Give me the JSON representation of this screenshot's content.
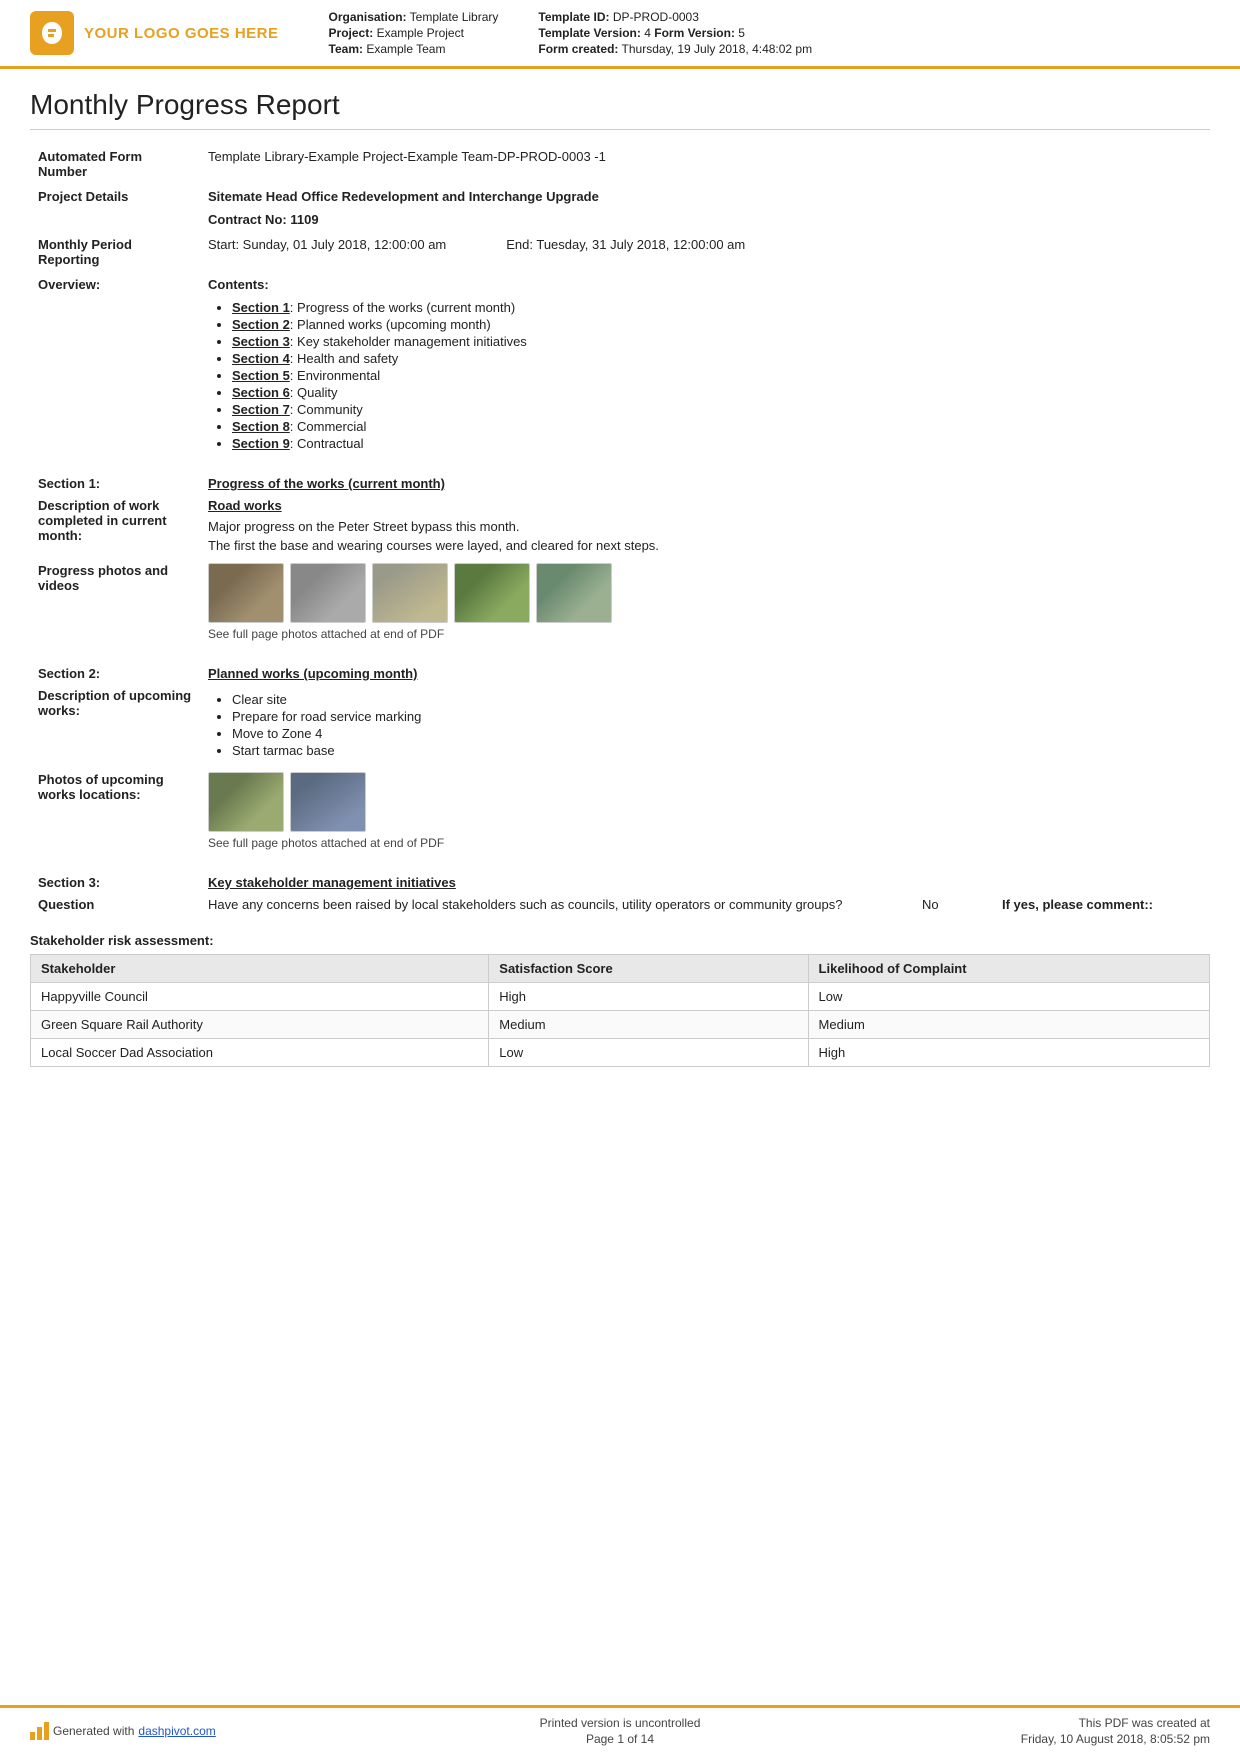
{
  "header": {
    "logo_text": "YOUR LOGO GOES HERE",
    "org_label": "Organisation:",
    "org_value": "Template Library",
    "project_label": "Project:",
    "project_value": "Example Project",
    "team_label": "Team:",
    "team_value": "Example Team",
    "template_id_label": "Template ID:",
    "template_id_value": "DP-PROD-0003",
    "template_version_label": "Template Version:",
    "template_version_value": "4",
    "form_version_label": "Form Version:",
    "form_version_value": "5",
    "form_created_label": "Form created:",
    "form_created_value": "Thursday, 19 July 2018, 4:48:02 pm"
  },
  "report": {
    "title": "Monthly Progress Report",
    "form_number_label": "Automated Form Number",
    "form_number_value": "Template Library-Example Project-Example Team-DP-PROD-0003   -1",
    "project_details_label": "Project Details",
    "project_details_value": "Sitemate Head Office Redevelopment and Interchange Upgrade",
    "contract_label": "Contract No:",
    "contract_value": "1109",
    "period_label": "Monthly Period Reporting",
    "period_start": "Start: Sunday, 01 July 2018, 12:00:00 am",
    "period_end": "End: Tuesday, 31 July 2018, 12:00:00 am",
    "overview_label": "Overview:",
    "contents_label": "Contents:",
    "contents": [
      {
        "id": "Section 1",
        "text": "Progress of the works (current month)"
      },
      {
        "id": "Section 2",
        "text": "Planned works (upcoming month)"
      },
      {
        "id": "Section 3",
        "text": "Key stakeholder management initiatives"
      },
      {
        "id": "Section 4",
        "text": "Health and safety"
      },
      {
        "id": "Section 5",
        "text": "Environmental"
      },
      {
        "id": "Section 6",
        "text": "Quality"
      },
      {
        "id": "Section 7",
        "text": "Community"
      },
      {
        "id": "Section 8",
        "text": "Commercial"
      },
      {
        "id": "Section 9",
        "text": "Contractual"
      }
    ],
    "section1_label": "Section 1:",
    "section1_title": "Progress of the works (current month)",
    "desc_work_label": "Description of work completed in current month:",
    "road_works_title": "Road works",
    "road_works_desc1": "Major progress on the Peter Street bypass this month.",
    "road_works_desc2": "The first the base and wearing courses were layed, and cleared for next steps.",
    "photos_label": "Progress photos and videos",
    "photos_caption": "See full page photos attached at end of PDF",
    "section2_label": "Section 2:",
    "section2_title": "Planned works (upcoming month)",
    "upcoming_works_label": "Description of upcoming works:",
    "upcoming_works": [
      "Clear site",
      "Prepare for road service marking",
      "Move to Zone 4",
      "Start tarmac base"
    ],
    "upcoming_photos_label": "Photos of upcoming works locations:",
    "upcoming_photos_caption": "See full page photos attached at end of PDF",
    "section3_label": "Section 3:",
    "section3_title": "Key stakeholder management initiatives",
    "question_label": "Question",
    "question_text": "Have any concerns been raised by local stakeholders such as councils, utility operators or community groups?",
    "question_answer": "No",
    "question_if_yes": "If yes, please comment::",
    "stakeholder_title": "Stakeholder risk assessment:",
    "stake_headers": [
      "Stakeholder",
      "Satisfaction Score",
      "Likelihood of Complaint"
    ],
    "stake_rows": [
      [
        "Happyville Council",
        "High",
        "Low"
      ],
      [
        "Green Square Rail Authority",
        "Medium",
        "Medium"
      ],
      [
        "Local Soccer Dad Association",
        "Low",
        "High"
      ]
    ]
  },
  "footer": {
    "generated_text": "Generated with",
    "link_text": "dashpivot.com",
    "printed_line1": "Printed version is uncontrolled",
    "printed_line2": "Page 1 of 14",
    "created_line1": "This PDF was created at",
    "created_line2": "Friday, 10 August 2018, 8:05:52 pm"
  }
}
